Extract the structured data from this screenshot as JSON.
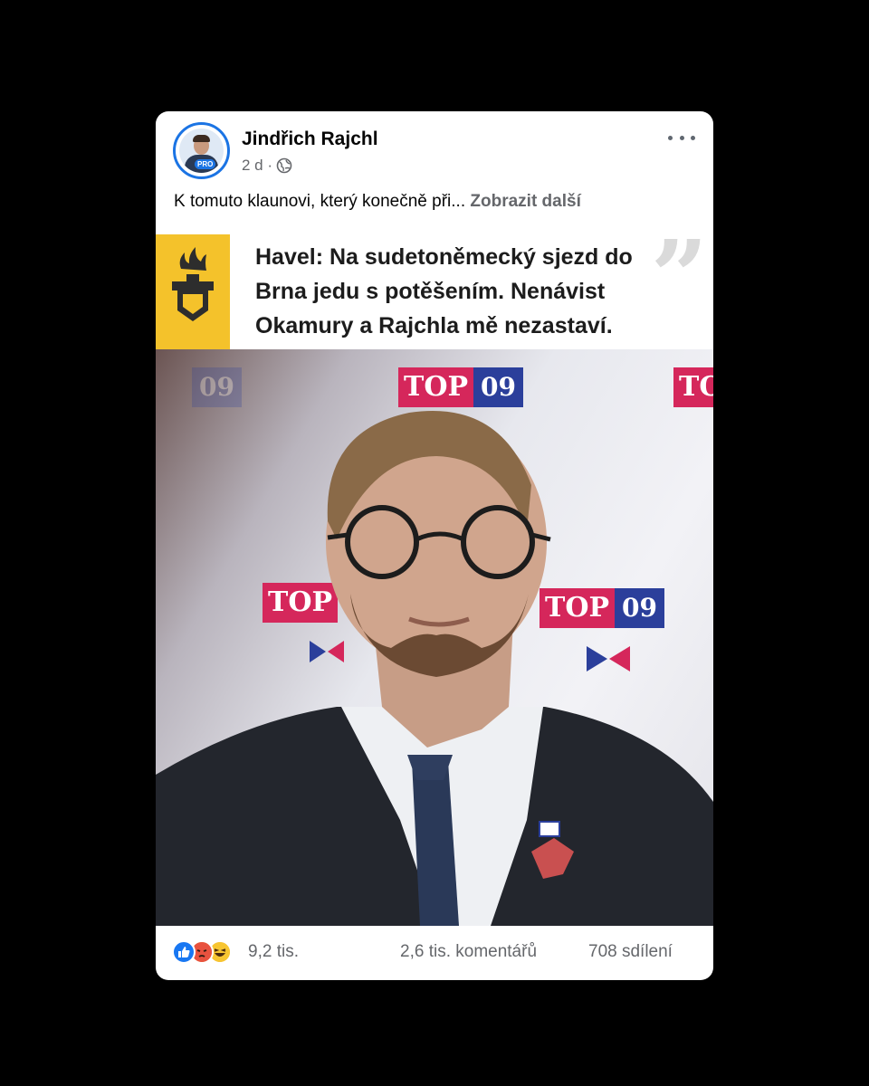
{
  "post": {
    "author": "Jindřich Rajchl",
    "time": "2 d",
    "avatar_badge": "PRO",
    "text": "K tomuto klaunovi, který konečně při...",
    "see_more": "Zobrazit další",
    "icons": [
      "avatar",
      "globe-icon",
      "more-options-icon"
    ]
  },
  "media": {
    "headline": "Havel: Na sudetoněmecký sjezd do Brna jedu s potěšením. Nenávist Okamury a Rajchla mě nezastaví.",
    "logo_text_top": "TOP",
    "logo_text_09": "09",
    "colors": {
      "banner_yellow": "#f4c22b",
      "top_pink": "#d5275b",
      "top_blue": "#2b3f9b"
    }
  },
  "stats": {
    "reactions": "9,2 tis.",
    "comments": "2,6 tis. komentářů",
    "shares": "708 sdílení",
    "reaction_icons": [
      "like-icon",
      "angry-icon",
      "haha-icon"
    ]
  }
}
